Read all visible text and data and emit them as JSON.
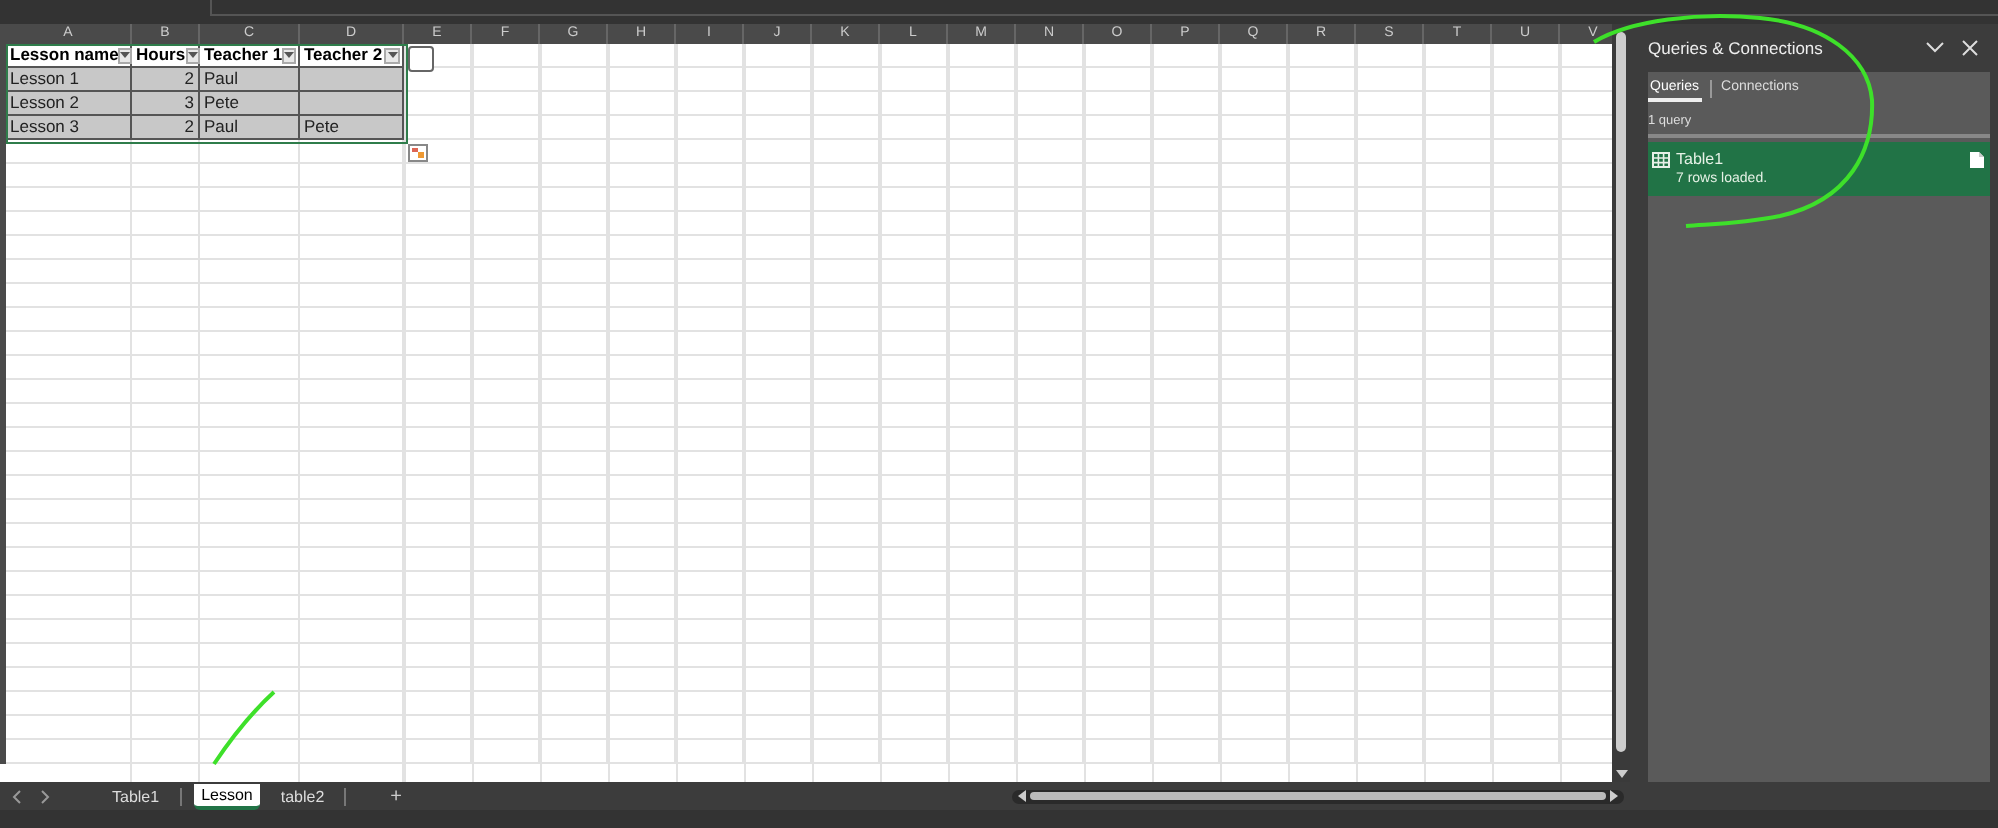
{
  "columns": [
    "A",
    "B",
    "C",
    "D",
    "E",
    "F",
    "G",
    "H",
    "I",
    "J",
    "K",
    "L",
    "M",
    "N",
    "O",
    "P",
    "Q",
    "R",
    "S",
    "T",
    "U",
    "V"
  ],
  "table": {
    "headers": [
      "Lesson name",
      "Hours",
      "Teacher 1",
      "Teacher 2"
    ],
    "rows": [
      [
        "Lesson 1",
        "2",
        "Paul",
        ""
      ],
      [
        "Lesson 2",
        "3",
        "Pete",
        ""
      ],
      [
        "Lesson 3",
        "2",
        "Paul",
        "Pete"
      ]
    ]
  },
  "sheet_tabs": [
    {
      "label": "Table1",
      "selected": false
    },
    {
      "label": "Lesson",
      "selected": true
    },
    {
      "label": "table2",
      "selected": false
    }
  ],
  "add_sheet": "+",
  "pane": {
    "title": "Queries & Connections",
    "tabs": [
      {
        "label": "Queries",
        "selected": true
      },
      {
        "label": "Connections",
        "selected": false
      }
    ],
    "count": "1 query",
    "queries": [
      {
        "name": "Table1",
        "status": "7 rows loaded."
      }
    ]
  }
}
